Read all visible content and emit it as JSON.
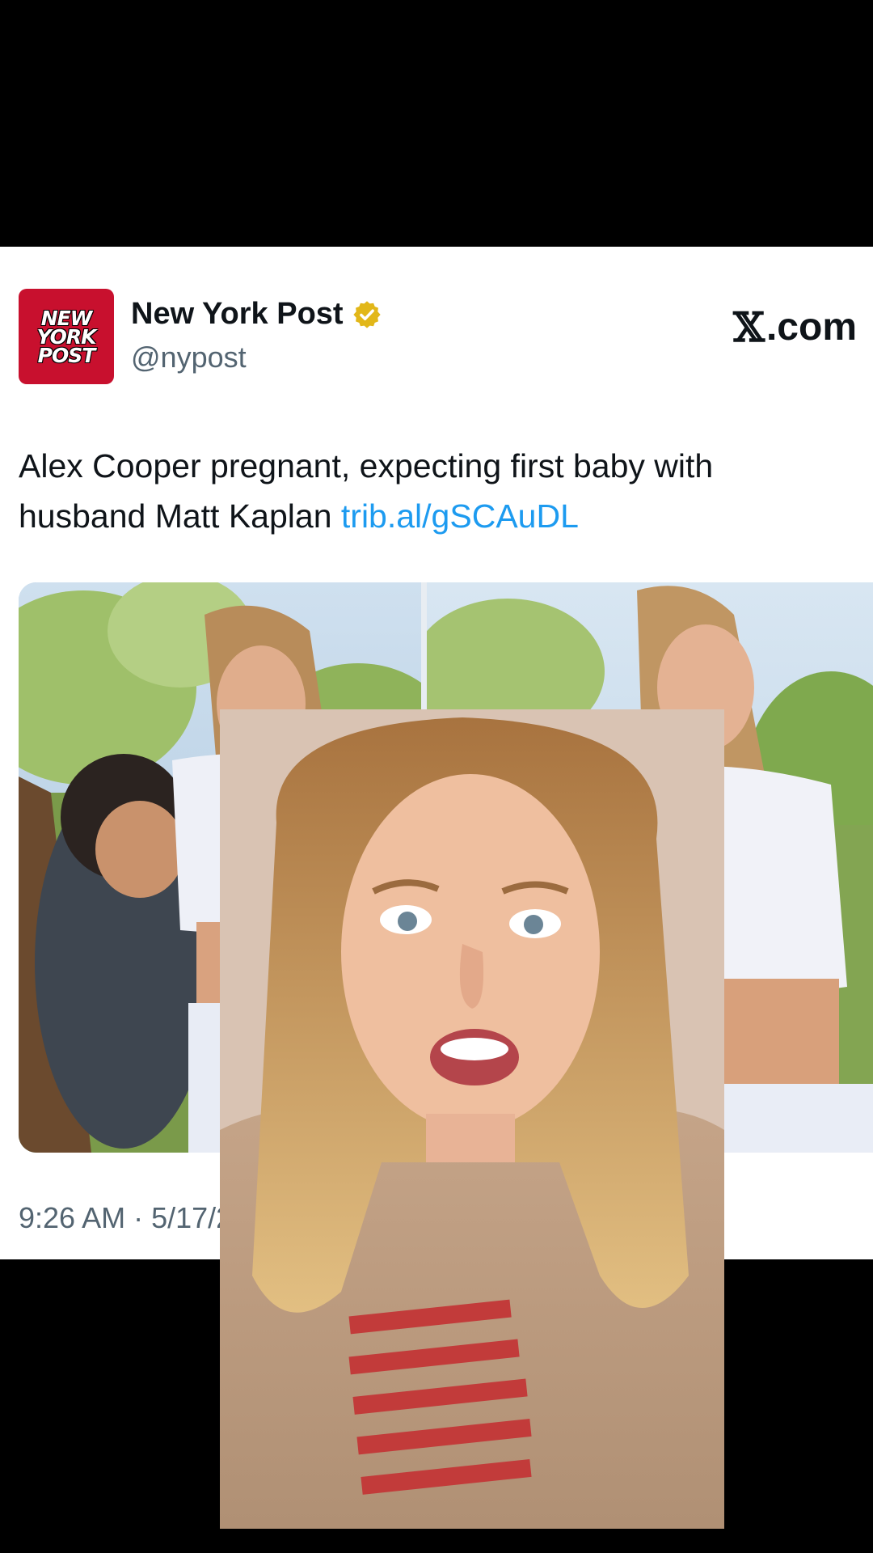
{
  "post": {
    "display_name": "New York Post",
    "handle": "@nypost",
    "avatar_text": [
      "NEW",
      "YORK",
      "POST"
    ],
    "site_label": ".com",
    "text": "Alex Cooper pregnant, expecting first baby with husband Matt Kaplan",
    "link": "trib.al/gSCAuDL",
    "timestamp": "9:26 AM · 5/17/2"
  },
  "colors": {
    "brand_red": "#c8102e",
    "verified_gold": "#e2b719",
    "link_blue": "#1d9bf0",
    "text_dark": "#0f1419",
    "text_muted": "#536471"
  },
  "icons": {
    "verified": "verified-badge-icon",
    "x_logo": "x-logo-icon"
  }
}
